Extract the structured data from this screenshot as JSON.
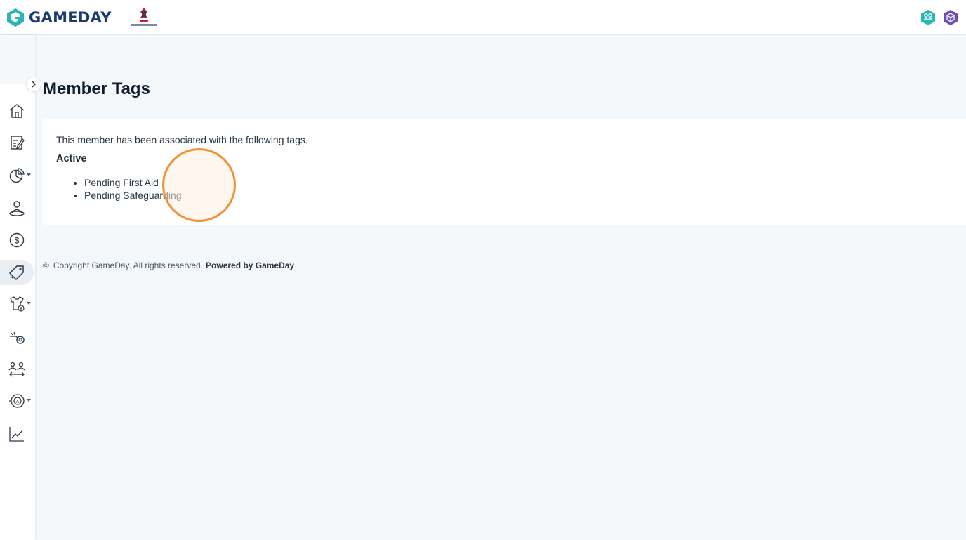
{
  "header": {
    "brand": "GAMEDAY",
    "org_logo_name": "ice-hockey-uk-logo",
    "icons": [
      "members-hex-icon",
      "profile-hex-icon"
    ]
  },
  "sidebar": {
    "items": [
      {
        "icon": "home-icon"
      },
      {
        "icon": "form-edit-icon"
      },
      {
        "icon": "reports-pie-icon",
        "has_submenu": true
      },
      {
        "icon": "member-location-icon"
      },
      {
        "icon": "dollar-icon"
      },
      {
        "icon": "tags-icon",
        "active": true
      },
      {
        "icon": "jersey-add-icon",
        "has_submenu": true
      },
      {
        "icon": "whistle-icon"
      },
      {
        "icon": "transfers-icon"
      },
      {
        "icon": "accreditation-icon",
        "has_submenu": true
      },
      {
        "icon": "analytics-icon"
      }
    ]
  },
  "main": {
    "title": "Member Tags",
    "intro": "This member has been associated with the following tags.",
    "section_heading": "Active",
    "tags": [
      "Pending First Aid",
      "Pending Safeguarding"
    ]
  },
  "footer": {
    "copyright_symbol": "©",
    "copyright": "Copyright GameDay. All rights reserved.",
    "powered_by": "Powered by GameDay"
  },
  "colors": {
    "brand_teal": "#2bb5b5",
    "brand_navy": "#1e3a73",
    "accent_purple": "#6b4fbb",
    "click_highlight": "#f0923a",
    "background": "#f5f8fb"
  }
}
